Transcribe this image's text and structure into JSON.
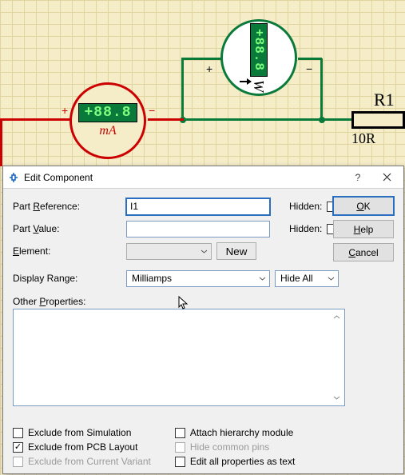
{
  "schematic": {
    "ammeter": {
      "reading": "+88.8",
      "unit": "mA",
      "plus": "+",
      "minus": "−"
    },
    "wattmeter": {
      "reading": "+88.8",
      "unit": "W",
      "plus": "+",
      "minus": "−"
    },
    "resistor": {
      "ref": "R1",
      "value": "10R"
    }
  },
  "dialog": {
    "title": "Edit Component",
    "help_symbol": "?",
    "fields": {
      "part_reference": {
        "label_pre": "Part ",
        "label_u": "R",
        "label_post": "eference:",
        "value": "I1"
      },
      "part_value": {
        "label_pre": "Part ",
        "label_u": "V",
        "label_post": "alue:",
        "value": ""
      },
      "element": {
        "label_u": "E",
        "label_post": "lement:",
        "value": "",
        "new_btn_u": "N",
        "new_btn_post": "ew"
      },
      "display_range": {
        "label": "Display Range:",
        "value": "Milliamps"
      },
      "hide": {
        "value": "Hide All"
      },
      "hidden_label": "Hidden:",
      "other_props": {
        "label_pre": "Other ",
        "label_u": "P",
        "label_post": "roperties:"
      }
    },
    "buttons": {
      "ok_u": "O",
      "ok_post": "K",
      "help_u": "H",
      "help_post": "elp",
      "cancel_u": "C",
      "cancel_post": "ancel"
    },
    "options": {
      "exclude_sim": {
        "pre": "Exclude from ",
        "u": "S",
        "post": "imulation",
        "checked": false
      },
      "exclude_pcb": {
        "pre": "Exclude from PCB ",
        "u": "L",
        "post": "ayout",
        "checked": true
      },
      "exclude_variant": {
        "pre": "Exclude from Current ",
        "u": "V",
        "post": "ariant",
        "checked": false,
        "disabled": true
      },
      "attach_hier": {
        "pre": "",
        "u": "A",
        "post": "ttach hierarchy module",
        "checked": false
      },
      "hide_common": {
        "pre": "Hide ",
        "u": "c",
        "post": "ommon pins",
        "checked": false,
        "disabled": true
      },
      "edit_all": {
        "pre": "Edit ",
        "u": "a",
        "post": "ll properties as text",
        "checked": false
      }
    }
  }
}
